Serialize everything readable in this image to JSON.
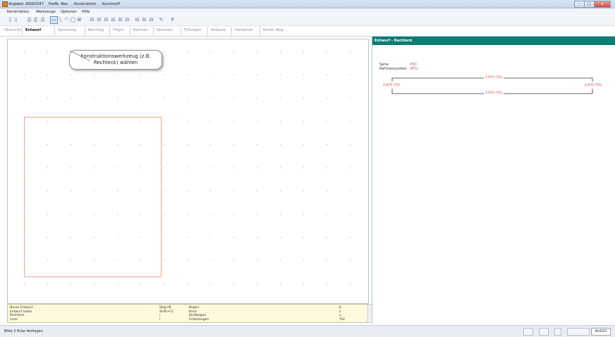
{
  "titlebar": {
    "items": [
      "Angebot: A0003347",
      "PosNr: Neu",
      "Konstruktion",
      "Kunststoff"
    ],
    "controls": [
      "–",
      "□",
      "x"
    ]
  },
  "menubar": {
    "items": [
      "Konstruktion",
      "Werkzeuge",
      "Optionen",
      "Hilfe"
    ]
  },
  "toolbar": {
    "icons": [
      "new-icon",
      "new-icon",
      "print-icon",
      "print-icon",
      "print-icon",
      "rectangle-tool-icon",
      "line-tool-icon",
      "arc-tool-icon",
      "circle-tool-icon",
      "wing-tool-icon",
      "split-tool-icon",
      "split-tool-icon",
      "split-tool-icon",
      "split-tool-icon",
      "split-tool-icon",
      "split-tool-icon",
      "split-tool-icon",
      "split-tool-icon",
      "split-tool-icon",
      "magic-tool-icon",
      "delete-tool-icon"
    ],
    "glyphs": [
      "▯",
      "▯",
      "⎙",
      "⎙",
      "⎙",
      "▭",
      "╲",
      "◠",
      "◯",
      "⊞",
      "⊟",
      "⊟",
      "⊟",
      "⊟",
      "⊟",
      "⊟",
      "⊟",
      "⊟",
      "⊟",
      "✎",
      "✗"
    ],
    "selected_index": 5
  },
  "tabs": [
    {
      "label": "Übersicht",
      "active": false
    },
    {
      "label": "Entwurf",
      "active": true
    },
    {
      "label": "Sprossung",
      "active": false
    },
    {
      "label": "Beschlag",
      "active": false
    },
    {
      "label": "Flügel",
      "active": false
    },
    {
      "label": "Rahmen",
      "active": false
    },
    {
      "label": "Sprossen",
      "active": false
    },
    {
      "label": "Füllungen",
      "active": false
    },
    {
      "label": "Anbaute",
      "active": false
    },
    {
      "label": "Handstutz",
      "active": false
    },
    {
      "label": "Konstr.-Beg.",
      "active": false
    }
  ],
  "callout": {
    "line1": "Konstruktionswerkzeug (z.B.",
    "line2": "Rechteck) wählen"
  },
  "shortcuts": {
    "col1": [
      "Neuer Entwurf",
      "Entwurf laden",
      "Rechteck",
      "Linie"
    ],
    "col2": [
      "Strg+N",
      "Shift+F2",
      "r",
      "l"
    ],
    "col3": [
      "Bogen",
      "Kreis",
      "Korbbogen",
      "Ersteilungen"
    ],
    "col4": [
      "b",
      "k",
      "n",
      "TLE"
    ]
  },
  "panel": {
    "header": "Entwurf - Rechteck",
    "serie_label": "Serie",
    "serie_value": "PVC",
    "rahmen_label": "Rahmensystem",
    "rahmen_value": "BTU",
    "dim_top": "1.870 (TQ)",
    "dim_bottom": "1.870 (TQ)",
    "dim_left": "4.870 (TO)",
    "dim_right": "4.870 (TO)"
  },
  "statusbar": {
    "text": "Bitte 2 Ecke festlegen",
    "right_box": "AUS10"
  },
  "colors": {
    "panel_header": "#0b7d73",
    "rectangle_outline": "#e9a58a",
    "dimension_text": "#d3402d",
    "shortcut_bg": "#fdf9dc"
  }
}
